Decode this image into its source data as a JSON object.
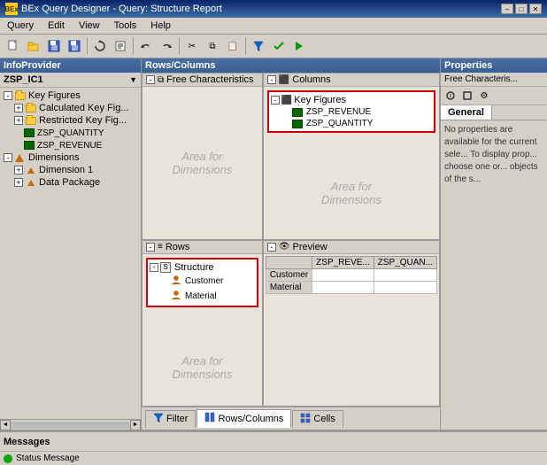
{
  "titlebar": {
    "icon": "BEx",
    "title": "BEx Query Designer - Query: Structure Report",
    "min_label": "–",
    "max_label": "□",
    "close_label": "✕"
  },
  "menubar": {
    "items": [
      "Query",
      "Edit",
      "View",
      "Tools",
      "Help"
    ]
  },
  "infoprovider": {
    "header": "InfoProvider",
    "datasource": "ZSP_IC1",
    "tree": {
      "key_figures_label": "Key Figures",
      "calc_key_fig_label": "Calculated Key Fig...",
      "restricted_key_fig_label": "Restricted Key Fig...",
      "zsp_quantity_label": "ZSP_QUANTITY",
      "zsp_revenue_label": "ZSP_REVENUE",
      "dimensions_label": "Dimensions",
      "dimension1_label": "Dimension 1",
      "data_package_label": "Data Package"
    }
  },
  "rows_columns": {
    "header": "Rows/Columns",
    "free_characteristics": {
      "label": "Free Characteristics",
      "watermark_line1": "Area for",
      "watermark_line2": "Dimensions"
    },
    "columns": {
      "label": "Columns",
      "key_figures_label": "Key Figures",
      "items": [
        "ZSP_REVENUE",
        "ZSP_QUANTITY"
      ],
      "watermark_line1": "Area for",
      "watermark_line2": "Dimensions"
    },
    "rows": {
      "label": "Rows",
      "structure_label": "Structure",
      "customer_label": "Customer",
      "material_label": "Material",
      "watermark_line1": "Area for",
      "watermark_line2": "Dimensions"
    },
    "preview": {
      "label": "Preview",
      "col1": "ZSP_REVE...",
      "col2": "ZSP_QUAN...",
      "row1": "Customer",
      "row2": "Material"
    }
  },
  "bottom_tabs": {
    "filter_label": "Filter",
    "rows_columns_label": "Rows/Columns",
    "cells_label": "Cells"
  },
  "properties": {
    "header": "Properties",
    "subtitle": "Free Characteris...",
    "general_tab": "General",
    "description": "No properties are available for the current sele... To display prop... choose one or... objects of the s..."
  },
  "messages": {
    "header": "Messages",
    "status": "Status Message"
  }
}
